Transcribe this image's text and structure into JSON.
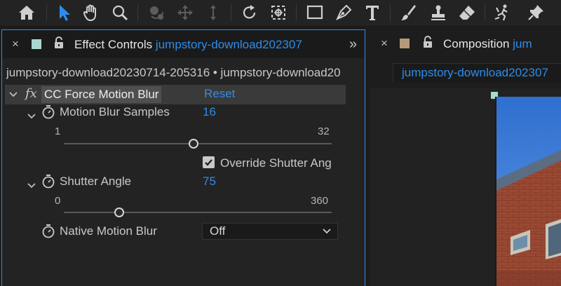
{
  "toolbar": {
    "tools": [
      "home-icon",
      "selection-arrow-icon",
      "hand-icon",
      "zoom-icon",
      "rotate-orbit-icon",
      "move-icon",
      "dolly-icon",
      "rotation-icon",
      "anchor-point-icon",
      "rectangle-icon",
      "pen-icon",
      "type-icon",
      "brush-icon",
      "clone-stamp-icon",
      "eraser-icon",
      "puppet-icon",
      "pin-icon"
    ]
  },
  "effect_controls": {
    "tab_close": "×",
    "tab_title": "Effect Controls",
    "tab_source": "jumpstory-download202307",
    "more": "»",
    "path": "jumpstory-download20230714-205316 • jumpstory-download20",
    "effect": {
      "fx": "fx",
      "name": "CC Force Motion Blur",
      "reset": "Reset"
    },
    "samples": {
      "label": "Motion Blur Samples",
      "value": "16",
      "min": "1",
      "max": "32",
      "level_fraction": 0.484
    },
    "override": {
      "label": "Override Shutter Ang",
      "checked": true
    },
    "shutter": {
      "label": "Shutter Angle",
      "value": "75",
      "min": "0",
      "max": "360",
      "level_fraction": 0.208
    },
    "native": {
      "label": "Native Motion Blur",
      "value": "Off"
    }
  },
  "composition": {
    "tab_close": "×",
    "tab_title": "Composition",
    "tab_source": "jum",
    "sub_tab": "jumpstory-download202307"
  },
  "colors": {
    "accent": "#2d8ceb",
    "swatch_ec": "#a8d8d0",
    "swatch_comp": "#b59a7a"
  }
}
